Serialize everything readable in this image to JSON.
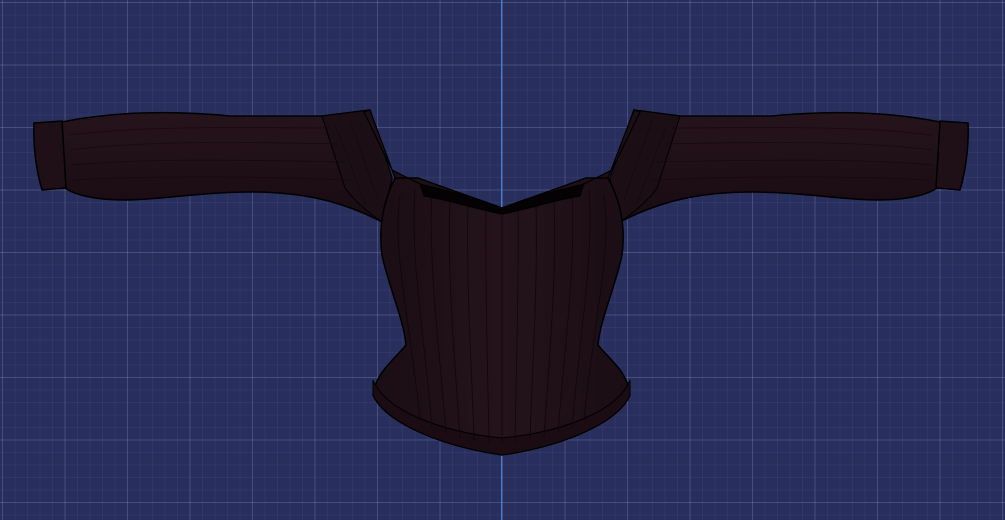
{
  "viewport": {
    "background_color": "#282f5c",
    "grid_color": "#4a5590",
    "axis_color": "#3f7fe0"
  },
  "model": {
    "name": "sweater-mesh",
    "body_color": "#22121a",
    "rib_color": "#120a0e",
    "outline_color": "#000000",
    "neck_opening_color": "#050203"
  }
}
